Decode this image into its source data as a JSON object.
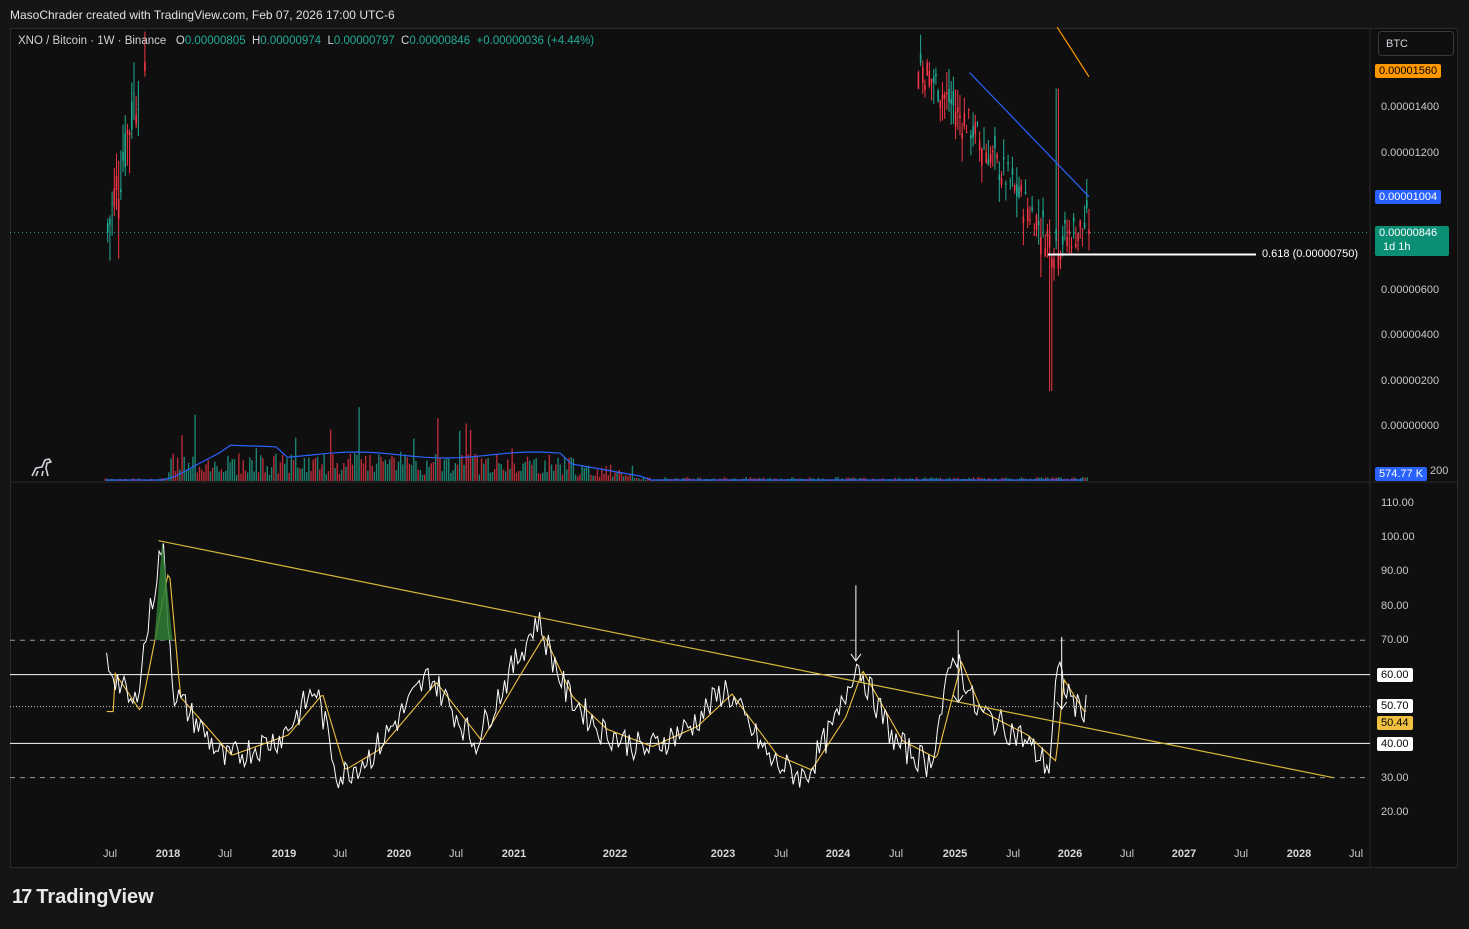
{
  "header": {
    "credit": "MasoChrader created with TradingView.com, Feb 07, 2026 17:00 UTC-6"
  },
  "legend": {
    "symbol": "XNO / Bitcoin · 1W · Binance",
    "o_label": "O",
    "o_value": "0.00000805",
    "h_label": "H",
    "h_value": "0.00000974",
    "l_label": "L",
    "l_value": "0.00000797",
    "c_label": "C",
    "c_value": "0.00000846",
    "change": "+0.00000036 (+4.44%)"
  },
  "currency_button": "BTC",
  "price_tags": {
    "orange": "0.00001560",
    "blue": "0.00001004",
    "last": "0.00000846",
    "countdown": "1d 1h",
    "volume": "574.77 K",
    "rsi": "50.70",
    "rsi_ma": "50.44"
  },
  "price_axis": [
    "0.00001400",
    "0.00001200",
    "0.00000600",
    "0.00000400",
    "0.00000200",
    "0.00000000"
  ],
  "volume_axis_fragment": "200",
  "fib_label": "0.618 (0.00000750)",
  "osc_axis": [
    "110.00",
    "100.00",
    "90.00",
    "80.00",
    "70.00",
    "60.00",
    "30.00",
    "20.00"
  ],
  "osc_box_labels": [
    "60.00",
    "40.00"
  ],
  "x_axis": [
    {
      "t": "Jul",
      "year": false
    },
    {
      "t": "2018",
      "year": true
    },
    {
      "t": "Jul",
      "year": false
    },
    {
      "t": "2019",
      "year": true
    },
    {
      "t": "Jul",
      "year": false
    },
    {
      "t": "2020",
      "year": true
    },
    {
      "t": "Jul",
      "year": false
    },
    {
      "t": "2021",
      "year": true
    },
    {
      "t": "2022",
      "year": true
    },
    {
      "t": "2023",
      "year": true
    },
    {
      "t": "Jul",
      "year": false
    },
    {
      "t": "2024",
      "year": true
    },
    {
      "t": "Jul",
      "year": false
    },
    {
      "t": "2025",
      "year": true
    },
    {
      "t": "Jul",
      "year": false
    },
    {
      "t": "2026",
      "year": true
    },
    {
      "t": "Jul",
      "year": false
    },
    {
      "t": "2027",
      "year": true
    },
    {
      "t": "Jul",
      "year": false
    },
    {
      "t": "2028",
      "year": true
    },
    {
      "t": "Jul",
      "year": false
    }
  ],
  "footer": {
    "brand": "TradingView",
    "mark": "17"
  },
  "colors": {
    "up": "#22ab94",
    "down": "#f23645",
    "ma_blue": "#2962ff",
    "ma_orange": "#ff9800",
    "rsi": "#ffffff",
    "rsi_ma": "#f0c040",
    "trend": "#d4b83a"
  },
  "chart_data": [
    {
      "type": "candlestick",
      "title": "XNO / Bitcoin · 1W · Binance",
      "y_unit": "BTC",
      "ylim": [
        0,
        1.55e-05
      ],
      "key_levels": {
        "last": 8.46e-06,
        "fib_0618": 7.5e-06,
        "ma_blue": 1.004e-05,
        "ma_orange": 1.56e-05
      },
      "lows": [
        {
          "date": "2017-06",
          "value": 6.2e-06
        },
        {
          "date": "2025-10",
          "value": 1.6e-06
        },
        {
          "date": "2026-01",
          "value": 7.3e-06
        }
      ]
    },
    {
      "type": "line",
      "title": "RSI",
      "ylim": [
        15,
        115
      ],
      "bands": [
        40,
        60
      ],
      "dashed_levels": [
        30,
        70
      ],
      "last": 50.7,
      "ma_last": 50.44,
      "peaks": [
        {
          "date": "2017-12",
          "value": 99
        },
        {
          "date": "2021-03",
          "value": 76
        },
        {
          "date": "2024-01",
          "value": 64
        },
        {
          "date": "2024-12",
          "value": 67
        },
        {
          "date": "2025-10",
          "value": 61
        }
      ],
      "trendline": [
        {
          "date": "2017-12",
          "value": 99
        },
        {
          "date": "2028-04",
          "value": 30
        }
      ]
    }
  ]
}
